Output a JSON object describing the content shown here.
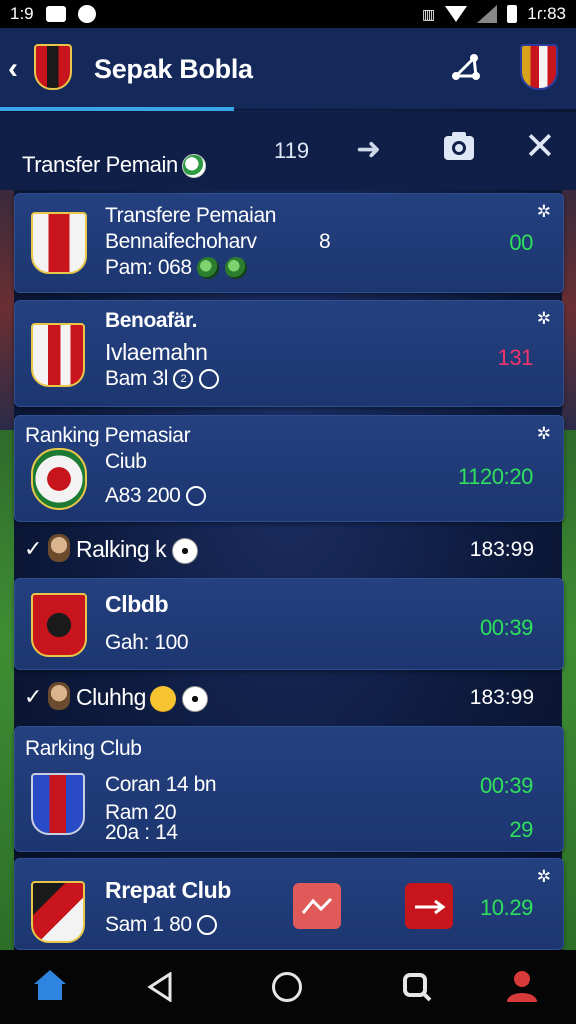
{
  "status_bar": {
    "time": "1:9",
    "clock": "1ɾ:83"
  },
  "header": {
    "title": "Sepak Bobla"
  },
  "sub_header": {
    "title": "Transfer Pemain",
    "count": "119"
  },
  "cards": [
    {
      "line1": "Transfere Pemaian",
      "line2": "Bennaifechoharv",
      "line2_extra": "8",
      "line3": "Pam: 068",
      "value": "00",
      "value_color": "#2ee05c"
    },
    {
      "line1": "Benoafär.",
      "line2": "Ivlaemahn",
      "line3": "Bam 3l",
      "line3_glyph": "2",
      "value": "131",
      "value_color": "#f0336a"
    },
    {
      "line1": "Ranking Pemasiar",
      "line2": "Ciub",
      "line3": "A83 200",
      "value": "1120:20",
      "value_color": "#2ee05c"
    },
    {
      "line1": "Clbdb",
      "line2": "Gah: 100",
      "value": "00:39",
      "value_color": "#2ee05c"
    },
    {
      "line1": "Rarking Club",
      "line2": "Coran 14 bn",
      "line3": "Ram 20",
      "line4": "20a : 14",
      "value": "00:39",
      "value2": "29",
      "value_color": "#2ee05c"
    },
    {
      "line1": "Rrepat Club",
      "line2": "Sam 1 80",
      "value": "10.29",
      "value_color": "#2ee05c"
    }
  ],
  "sections": [
    {
      "label": "Ralking k",
      "time": "183:99"
    },
    {
      "label": "Cluhhg",
      "time": "183:99"
    }
  ],
  "colors": {
    "accent": "#38a6e8",
    "card_bg": "#24407f",
    "green": "#2ee05c",
    "pink": "#f0336a"
  },
  "icons": [
    "back-icon",
    "share-icon",
    "arrow-right-icon",
    "camera-icon",
    "close-icon",
    "star-icon",
    "home-icon",
    "back-triangle-icon",
    "home-circle-icon",
    "search-icon",
    "profile-icon"
  ]
}
